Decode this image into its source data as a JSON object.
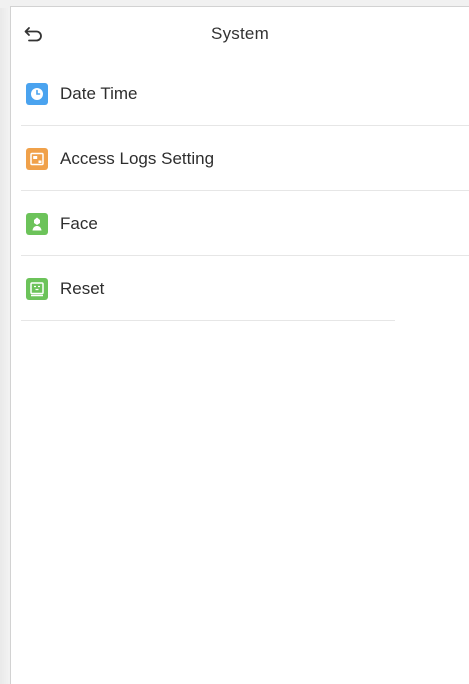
{
  "header": {
    "title": "System"
  },
  "menu": {
    "items": [
      {
        "label": "Date Time",
        "icon": "clock-icon",
        "color": "#4aa3ef"
      },
      {
        "label": "Access Logs Setting",
        "icon": "log-settings-icon",
        "color": "#f0a14a"
      },
      {
        "label": "Face",
        "icon": "face-icon",
        "color": "#6cc35a"
      },
      {
        "label": "Reset",
        "icon": "reset-icon",
        "color": "#6cc35a"
      }
    ]
  }
}
